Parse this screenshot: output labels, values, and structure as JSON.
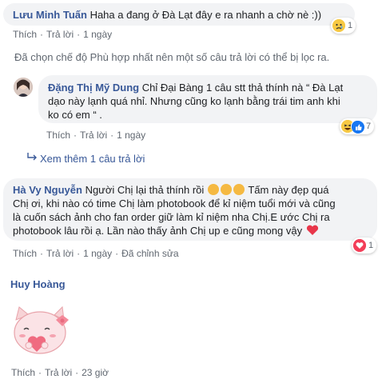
{
  "comments": [
    {
      "author": "Lưu Minh Tuấn",
      "text": "Haha a đang ở Đà Lạt đây e ra nhanh a chờ nè :))",
      "actions": {
        "like": "Thích",
        "reply": "Trả lời",
        "time": "1 ngày"
      },
      "reactions": {
        "icons": [
          "sad-icon"
        ],
        "count": "1"
      }
    },
    {
      "author": "Đặng Thị Mỹ Dung",
      "text_lines": [
        "Chỉ Đại Bàng 1 câu stt thả thính nà “ Đà Lạt",
        "dạo này lạnh quá nhỉ. Nhưng cũng ko lạnh bằng trái tim anh khi",
        "ko có em “ ."
      ],
      "actions": {
        "like": "Thích",
        "reply": "Trả lời",
        "time": "1 ngày"
      },
      "reactions": {
        "icons": [
          "haha-icon",
          "like-icon"
        ],
        "count": "7"
      }
    },
    {
      "author": "Hà Vy Nguyễn",
      "text_lines": [
        "Người Chị lại thả thính rồi",
        "Tấm này đẹp quá",
        "Chị ơi, khi nào có time Chị làm photobook để kỉ niệm tuổi mới và cũng",
        "là cuốn sách ảnh cho fan order giữ làm kỉ niệm nha Chị.E ước Chị ra",
        "photobook lâu rồi ạ. Lần nào thấy ảnh Chị up e cũng mong vậy"
      ],
      "actions": {
        "like": "Thích",
        "reply": "Trả lời",
        "time": "1 ngày",
        "edited": "Đã chỉnh sửa"
      },
      "reactions": {
        "icons": [
          "love-icon"
        ],
        "count": "1"
      }
    },
    {
      "author": "Huy Hoàng",
      "sticker": "pig-sticker",
      "actions": {
        "like": "Thích",
        "reply": "Trả lời",
        "time": "23 giờ"
      }
    }
  ],
  "filter_notice": "Đã chọn chế độ Phù hợp nhất nên một số câu trả lời có thể bị lọc ra.",
  "view_more": "Xem thêm 1 câu trả lời",
  "colors": {
    "link": "#385898",
    "meta": "#606770",
    "bubble": "#f2f3f5"
  }
}
